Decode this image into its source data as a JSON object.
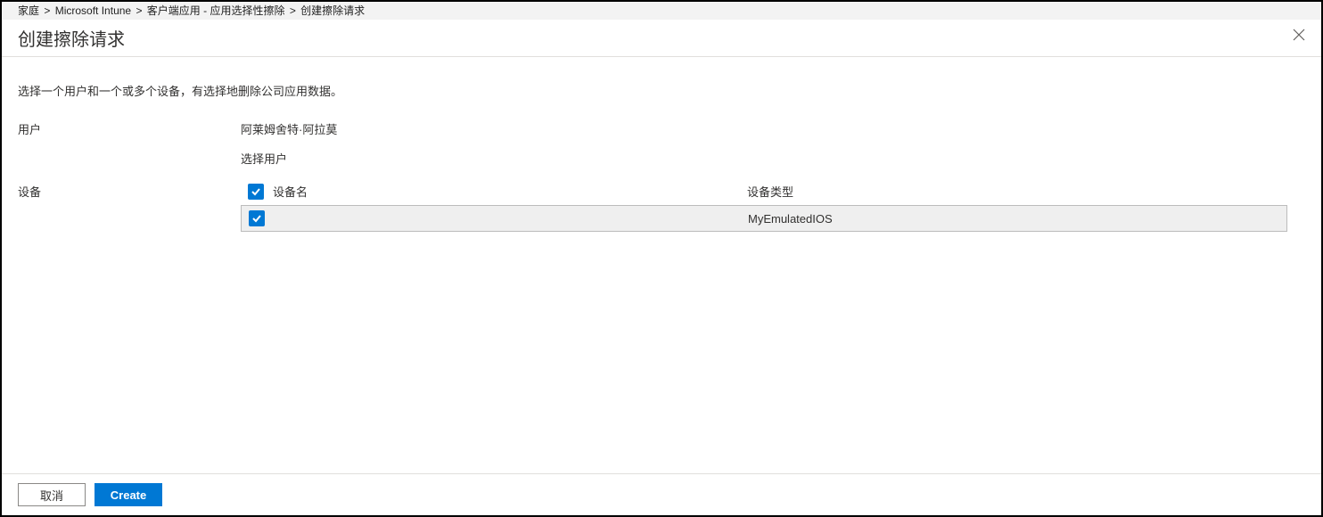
{
  "breadcrumb": {
    "items": [
      {
        "label": "家庭"
      },
      {
        "label": "Microsoft Intune"
      },
      {
        "label": "客户端应用 - 应用选择性擦除"
      },
      {
        "label": "创建擦除请求"
      }
    ],
    "sep": "&gt;"
  },
  "page_title": "创建擦除请求",
  "description": "选择一个用户和一个或多个设备，有选择地删除公司应用数据。",
  "user_section": {
    "label": "用户",
    "value": "阿莱姆舍特·阿拉莫",
    "select_link": "选择用户"
  },
  "device_section": {
    "label": "设备",
    "columns": {
      "name": "设备名",
      "type": "设备类型"
    },
    "select_all_checked": true,
    "rows": [
      {
        "name": "",
        "type": "MyEmulatedIOS",
        "checked": true
      }
    ]
  },
  "footer": {
    "cancel": "取消",
    "create": "Create"
  }
}
